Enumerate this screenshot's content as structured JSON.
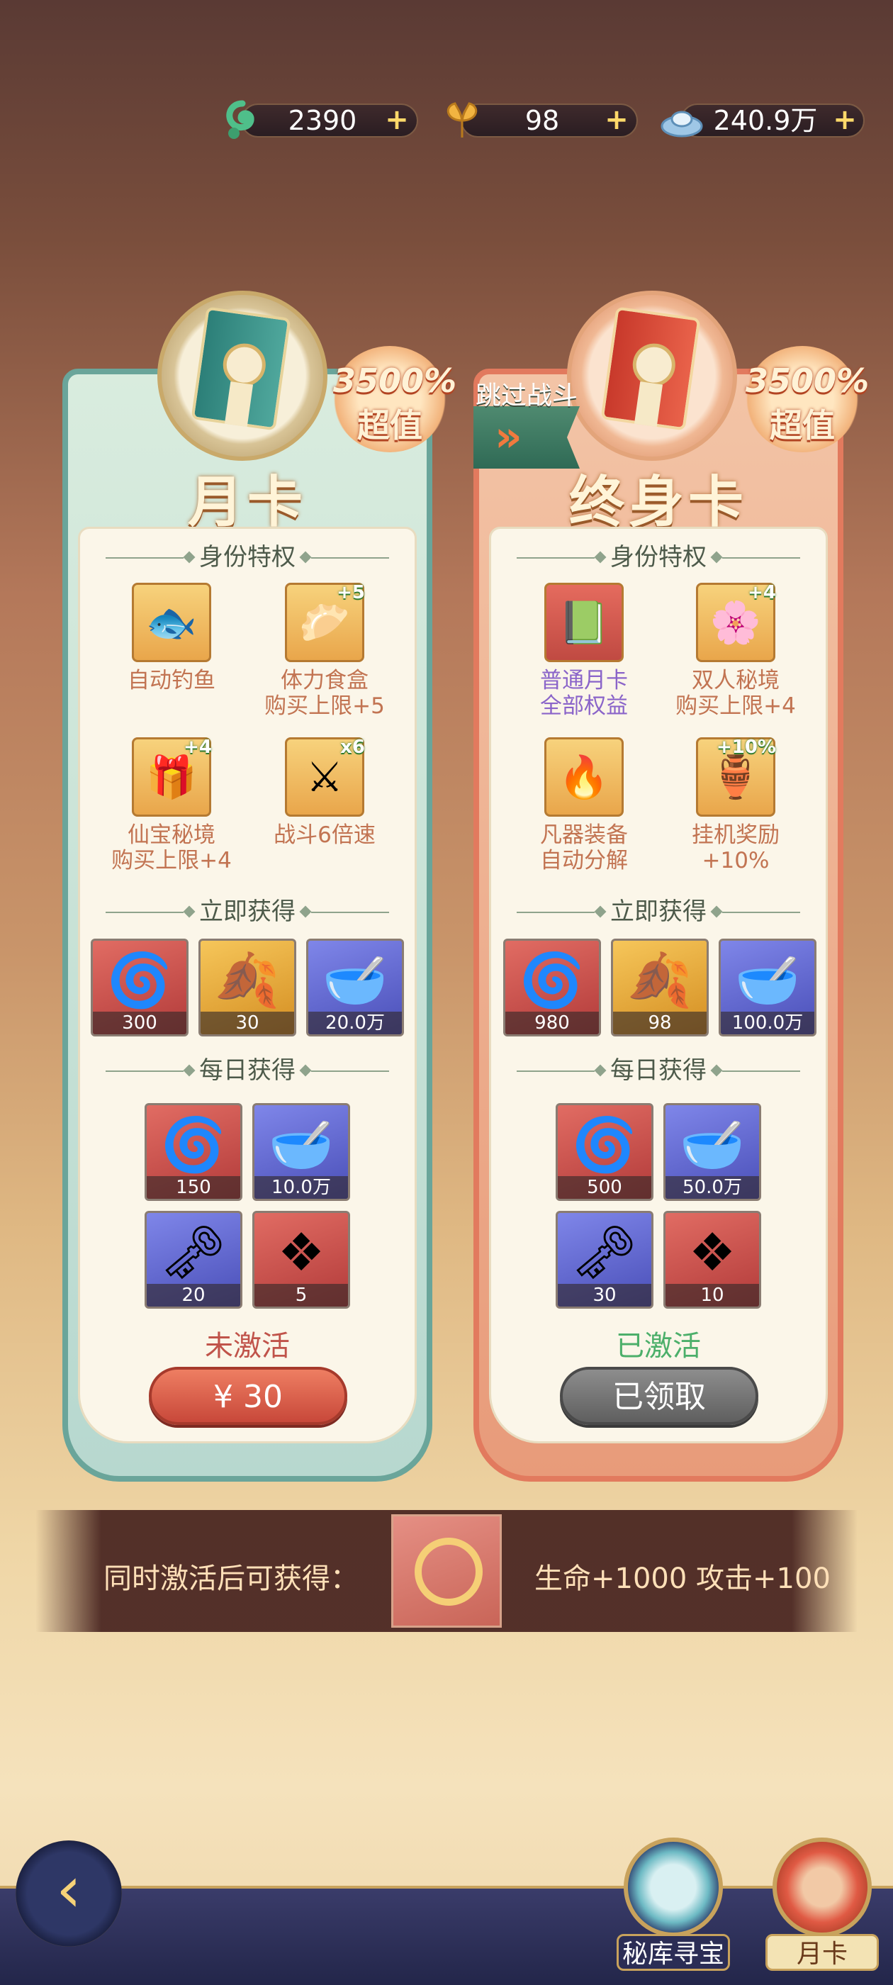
{
  "currencies": [
    {
      "name": "jade",
      "icon": "jade-icon",
      "value": "2390"
    },
    {
      "name": "leaf",
      "icon": "golden-leaf-icon",
      "value": "98"
    },
    {
      "name": "silver",
      "icon": "silver-ingot-icon",
      "value": "240.9万"
    }
  ],
  "plus_symbol": "+",
  "monthly_card": {
    "title": "月卡",
    "badge_pct": "3500%",
    "badge_label": "超值",
    "section_privileges": "身份特权",
    "perks": [
      {
        "icon": "koi-fish-icon",
        "label": "自动钓鱼"
      },
      {
        "icon": "food-box-icon",
        "tag": "+5",
        "label": "体力食盒\n购买上限+5"
      },
      {
        "icon": "treasure-icon",
        "tag": "+4",
        "label": "仙宝秘境\n购买上限+4"
      },
      {
        "icon": "crossed-swords-icon",
        "tag": "x6",
        "label": "战斗6倍速"
      }
    ],
    "section_instant": "立即获得",
    "instant": [
      {
        "icon": "jade-icon",
        "count": "300"
      },
      {
        "icon": "golden-leaf-icon",
        "count": "30"
      },
      {
        "icon": "silver-ingot-icon",
        "count": "20.0万"
      }
    ],
    "section_daily": "每日获得",
    "daily": [
      {
        "icon": "jade-icon",
        "count": "150"
      },
      {
        "icon": "silver-ingot-icon",
        "count": "10.0万"
      },
      {
        "icon": "golden-key-icon",
        "count": "20"
      },
      {
        "icon": "red-gem-icon",
        "count": "5"
      }
    ],
    "status": "未激活",
    "button": "¥ 30"
  },
  "lifetime_card": {
    "title": "终身卡",
    "badge_pct": "3500%",
    "badge_label": "超值",
    "skip_label": "跳过战斗",
    "section_privileges": "身份特权",
    "perks": [
      {
        "icon": "green-book-icon",
        "label": "普通月卡\n全部权益"
      },
      {
        "icon": "double-realm-icon",
        "tag": "+4",
        "label": "双人秘境\n购买上限+4"
      },
      {
        "icon": "fire-swords-icon",
        "label": "凡器装备\n自动分解"
      },
      {
        "icon": "treasure-chest-icon",
        "tag": "+10%",
        "label": "挂机奖励\n+10%"
      }
    ],
    "section_instant": "立即获得",
    "instant": [
      {
        "icon": "jade-icon",
        "count": "980"
      },
      {
        "icon": "golden-leaf-icon",
        "count": "98"
      },
      {
        "icon": "silver-ingot-icon",
        "count": "100.0万"
      }
    ],
    "section_daily": "每日获得",
    "daily": [
      {
        "icon": "jade-icon",
        "count": "500"
      },
      {
        "icon": "silver-ingot-icon",
        "count": "50.0万"
      },
      {
        "icon": "golden-key-icon",
        "count": "30"
      },
      {
        "icon": "red-gem-icon",
        "count": "10"
      }
    ],
    "status": "已激活",
    "button": "已领取"
  },
  "bonus": {
    "label": "同时激活后可获得：",
    "reward": "生命+1000 攻击+100"
  },
  "nav": {
    "treasure_label": "秘库寻宝",
    "monthly_label": "月卡"
  },
  "colors": {
    "teal_border": "#6aa59a",
    "red_border": "#e27a5e",
    "inactive_status": "#c0534a",
    "active_status": "#4caf6a"
  }
}
